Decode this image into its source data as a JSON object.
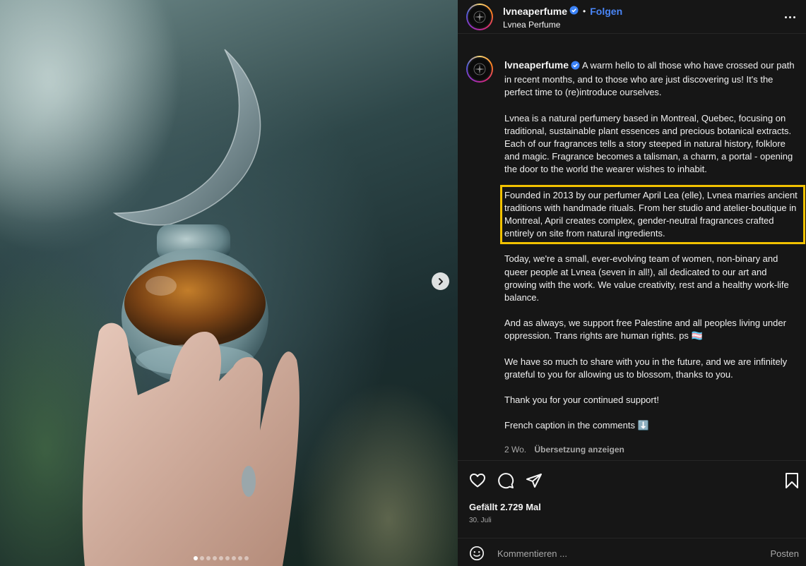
{
  "post": {
    "username": "lvneaperfume",
    "follow_label": "Folgen",
    "separator": "•",
    "subtitle": "Lvnea Perfume",
    "verified_icon": "verified-badge-icon",
    "more_icon": "more-options-icon"
  },
  "caption": {
    "username": "lvneaperfume",
    "intro": "A warm hello to all those who have crossed our path in recent months, and to those who are just discovering us! It's the perfect time to (re)introduce ourselves.",
    "para2": "Lvnea is a natural perfumery based in Montreal, Quebec, focusing on traditional, sustainable plant essences and precious botanical extracts. Each of our fragrances tells a story steeped in natural history, folklore and magic. Fragrance becomes a talisman, a charm, a portal - opening the door to the world the wearer wishes to inhabit.",
    "para3_highlighted": "Founded in 2013 by our perfumer April Lea (elle), Lvnea marries ancient traditions with handmade rituals. From her studio and atelier-boutique in Montreal, April creates complex, gender-neutral fragrances crafted entirely on site from natural ingredients.",
    "para4": "Today, we're a small, ever-evolving team of women, non-binary and queer people at Lvnea (seven in all!), all dedicated to our art and growing with the work. We value creativity, rest and a healthy work-life balance.",
    "para5": "And as always, we support free Palestine and all peoples living under oppression. Trans rights are human rights. ps 🏳️‍⚧️",
    "para6": "We have so much to share with you in the future, and we are infinitely grateful to you for allowing us to blossom, thanks to you.",
    "para7": "Thank you for your continued support!",
    "para8": "French caption in the comments ⬇️",
    "age": "2 Wo.",
    "translate_label": "Übersetzung anzeigen",
    "highlight_color": "#f2c200"
  },
  "actions": {
    "icons": [
      "heart-icon",
      "comment-icon",
      "share-icon",
      "bookmark-icon"
    ],
    "likes_text": "Gefällt 2.729 Mal",
    "date_text": "30. Juli"
  },
  "comment": {
    "placeholder": "Kommentieren ...",
    "post_label": "Posten",
    "emoji_icon": "emoji-icon"
  },
  "carousel": {
    "total_slides": 9,
    "active_slide": 1,
    "next_icon": "chevron-right-icon"
  }
}
